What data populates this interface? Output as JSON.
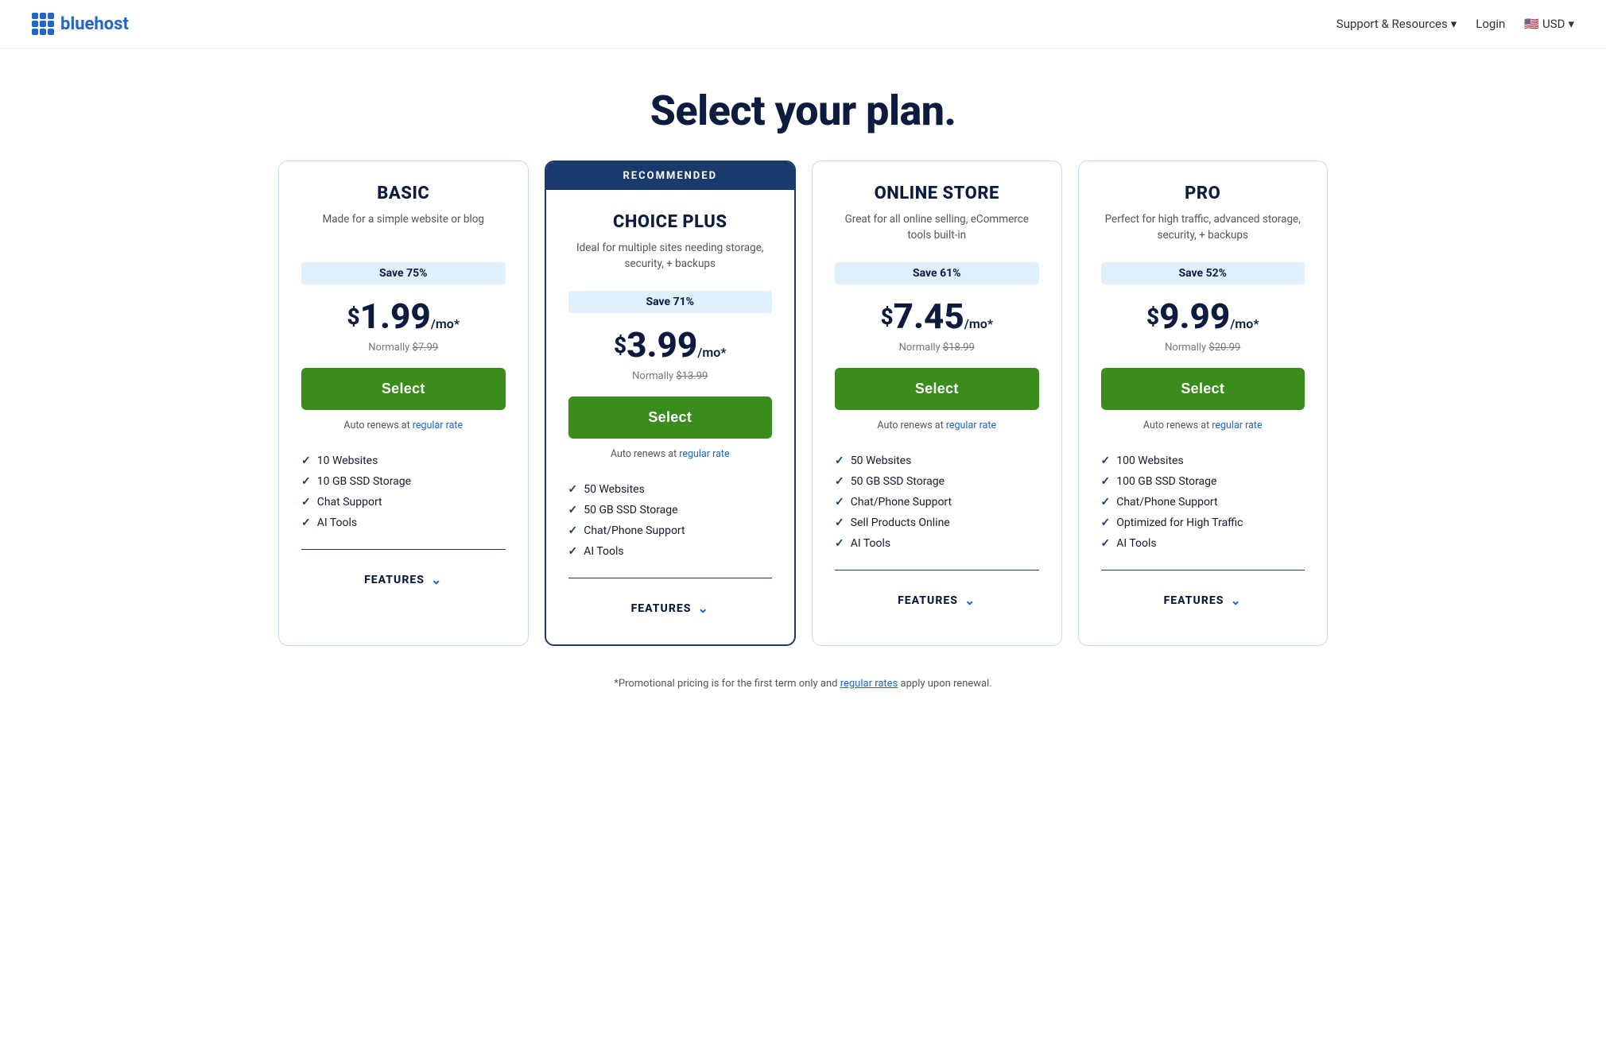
{
  "header": {
    "logo_text": "bluehost",
    "support_label": "Support & Resources",
    "support_dropdown": "▾",
    "login_label": "Login",
    "currency_flag": "🇺🇸",
    "currency_label": "USD",
    "currency_dropdown": "▾"
  },
  "page": {
    "title": "Select your plan."
  },
  "plans": [
    {
      "id": "basic",
      "recommended": false,
      "name": "BASIC",
      "description": "Made for a simple website or blog",
      "savings": "Save 75%",
      "price_dollar": "$",
      "price_amount": "1.99",
      "price_suffix": "/mo*",
      "price_normal": "Normally $7.99",
      "price_strikethrough": "$7.99",
      "select_label": "Select",
      "auto_renews": "Auto renews at",
      "regular_rate": "regular rate",
      "features": [
        "10 Websites",
        "10 GB SSD Storage",
        "Chat Support",
        "AI Tools"
      ],
      "features_label": "FEATURES"
    },
    {
      "id": "choice-plus",
      "recommended": true,
      "recommended_badge": "RECOMMENDED",
      "name": "CHOICE PLUS",
      "description": "Ideal for multiple sites needing storage, security, + backups",
      "savings": "Save 71%",
      "price_dollar": "$",
      "price_amount": "3.99",
      "price_suffix": "/mo*",
      "price_normal": "Normally $13.99",
      "price_strikethrough": "$13.99",
      "select_label": "Select",
      "auto_renews": "Auto renews at",
      "regular_rate": "regular rate",
      "features": [
        "50 Websites",
        "50 GB SSD Storage",
        "Chat/Phone Support",
        "AI Tools"
      ],
      "features_label": "FEATURES"
    },
    {
      "id": "online-store",
      "recommended": false,
      "name": "ONLINE STORE",
      "description": "Great for all online selling, eCommerce tools built-in",
      "savings": "Save 61%",
      "price_dollar": "$",
      "price_amount": "7.45",
      "price_suffix": "/mo*",
      "price_normal": "Normally $18.99",
      "price_strikethrough": "$18.99",
      "select_label": "Select",
      "auto_renews": "Auto renews at",
      "regular_rate": "regular rate",
      "features": [
        "50 Websites",
        "50 GB SSD Storage",
        "Chat/Phone Support",
        "Sell Products Online",
        "AI Tools"
      ],
      "features_label": "FEATURES"
    },
    {
      "id": "pro",
      "recommended": false,
      "name": "PRO",
      "description": "Perfect for high traffic, advanced storage, security, + backups",
      "savings": "Save 52%",
      "price_dollar": "$",
      "price_amount": "9.99",
      "price_suffix": "/mo*",
      "price_normal": "Normally $20.99",
      "price_strikethrough": "$20.99",
      "select_label": "Select",
      "auto_renews": "Auto renews at",
      "regular_rate": "regular rate",
      "features": [
        "100 Websites",
        "100 GB SSD Storage",
        "Chat/Phone Support",
        "Optimized for High Traffic",
        "AI Tools"
      ],
      "features_label": "FEATURES"
    }
  ],
  "footer_note": "*Promotional pricing is for the first term only and",
  "footer_rate_link": "regular rates",
  "footer_note_end": "apply upon renewal."
}
